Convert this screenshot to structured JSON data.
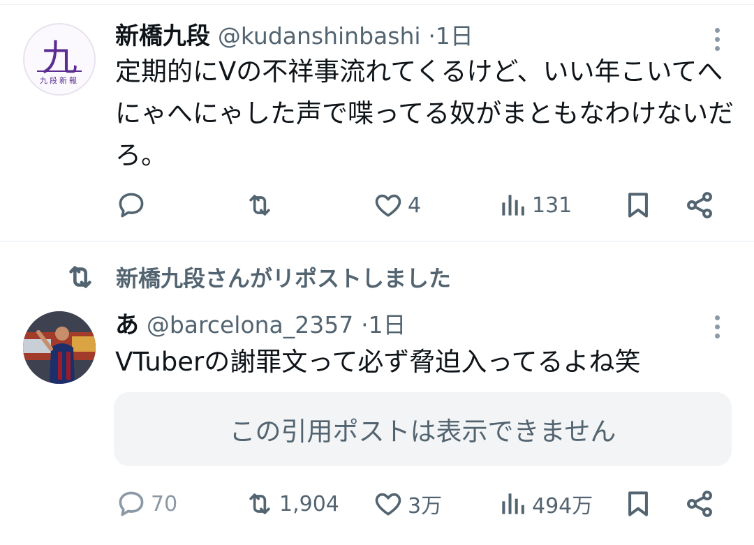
{
  "tweets": [
    {
      "avatar": {
        "kanji": "九",
        "sub": "九段新報",
        "colors": {
          "accent": "#5b2d91"
        }
      },
      "name": "新橋九段",
      "handle": "@kudanshinbashi",
      "separator": "·",
      "time": "1日",
      "text": "定期的にVの不祥事流れてくるけど、いい年こいてへにゃへにゃした声で喋ってる奴がまともなわけないだろ。",
      "actions": {
        "reply": "",
        "repost": "",
        "like": "4",
        "views": "131"
      }
    },
    {
      "repost_note": "新橋九段さんがリポストしました",
      "name": "あ",
      "handle": "@barcelona_2357",
      "separator": "·",
      "time": "1日",
      "text": "VTuberの謝罪文って必ず脅迫入ってるよね笑",
      "quote": "この引用ポストは表示できません",
      "actions": {
        "reply": "70",
        "repost": "1,904",
        "like": "3万",
        "views": "494万"
      }
    }
  ],
  "icons": {
    "reply": "reply-icon",
    "repost": "repost-icon",
    "like": "heart-icon",
    "views": "views-icon",
    "bookmark": "bookmark-icon",
    "share": "share-icon",
    "more": "more-icon"
  },
  "colors": {
    "text": "#0f1419",
    "muted": "#536471",
    "divider": "#e6ecf0",
    "quote_bg": "#f2f4f5"
  }
}
